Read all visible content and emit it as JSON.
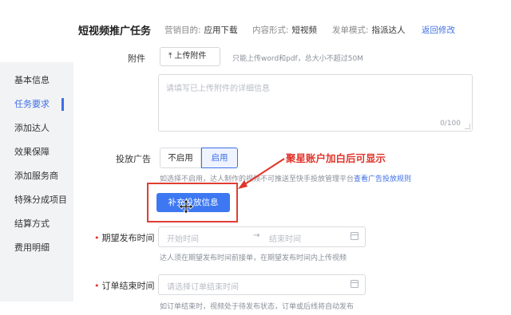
{
  "header": {
    "title": "短视频推广任务",
    "goal_label": "营销目的:",
    "goal_value": "应用下载",
    "format_label": "内容形式:",
    "format_value": "短视频",
    "dispatch_label": "发单模式:",
    "dispatch_value": "指派达人",
    "edit_link": "返回修改"
  },
  "sidebar": {
    "items": [
      {
        "label": "基本信息"
      },
      {
        "label": "任务要求"
      },
      {
        "label": "添加达人"
      },
      {
        "label": "效果保障"
      },
      {
        "label": "添加服务商"
      },
      {
        "label": "特殊分成项目"
      },
      {
        "label": "结算方式"
      },
      {
        "label": "费用明细"
      }
    ],
    "active_index": 1
  },
  "form": {
    "attachment": {
      "label": "附件",
      "upload_button": "上传附件",
      "hint": "只能上传word和pdf，总大小不超过50M",
      "textarea_placeholder": "请填写已上传附件的详细信息",
      "char_count": "0/100"
    },
    "ad_delivery": {
      "label": "投放广告",
      "option_off": "不启用",
      "option_on": "启用",
      "hint": "如选择不启用，达人制作的视频不可推送至快手投放管理平台",
      "hint_link": "查看广告投放规则",
      "supplement_button": "补充投放信息"
    },
    "publish_time": {
      "label": "期望发布时间",
      "start_placeholder": "开始时间",
      "separator": "→",
      "end_placeholder": "结束时间",
      "hint": "达人须在期望发布时间前接单，在期望发布时间内上传视频"
    },
    "order_end": {
      "label": "订单结束时间",
      "placeholder": "请选择订单结束时间",
      "hint": "如订单结束时，视频处于待发布状态，订单或后线将自动发布"
    }
  },
  "annotation": {
    "text": "聚星账户加白后可显示"
  },
  "colors": {
    "accent": "#3f6fe6",
    "primary_button": "#3d78f2",
    "annotation_red": "#e0352b"
  }
}
